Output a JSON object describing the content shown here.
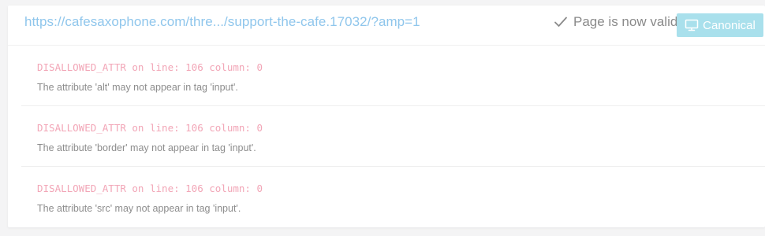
{
  "header": {
    "url": "https://cafesaxophone.com/thre.../support-the-cafe.17032/?amp=1",
    "status_text": "Page is now valid",
    "canonical_label": "Canonical",
    "status_icon": "check-icon",
    "canonical_icon": "monitor-icon"
  },
  "colors": {
    "link": "#8fc6ec",
    "status": "#8a8a8a",
    "button_bg": "#a9e0ec",
    "error_code": "#f2a6b7",
    "error_message": "#8d8d8d"
  },
  "errors": [
    {
      "code": "DISALLOWED_ATTR on line: 106 column: 0",
      "message": "The attribute 'alt' may not appear in tag 'input'."
    },
    {
      "code": "DISALLOWED_ATTR on line: 106 column: 0",
      "message": "The attribute 'border' may not appear in tag 'input'."
    },
    {
      "code": "DISALLOWED_ATTR on line: 106 column: 0",
      "message": "The attribute 'src' may not appear in tag 'input'."
    }
  ]
}
